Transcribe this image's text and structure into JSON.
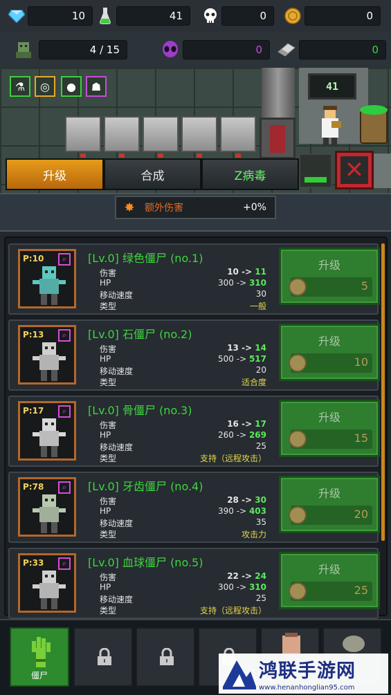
{
  "resources": {
    "gems": "10",
    "potion": "41",
    "skull": "0",
    "coins": "0",
    "zombies": "4 / 15",
    "alien": "0",
    "eraser": "0"
  },
  "scene": {
    "screen_counter": "41"
  },
  "tabs": [
    {
      "label": "升级"
    },
    {
      "label": "合成"
    },
    {
      "label": "Z病毒"
    }
  ],
  "bonus": {
    "label": "额外伤害",
    "value": "+0%"
  },
  "stat_labels": {
    "damage": "伤害",
    "hp": "HP",
    "speed": "移动速度",
    "type": "类型"
  },
  "upgrade_label": "升级",
  "zombies": [
    {
      "power": "P:10",
      "title": "[Lv.0] 绿色僵尸 (no.1)",
      "damage_from": "10",
      "damage_to": "11",
      "hp_from": "300",
      "hp_to": "310",
      "speed": "30",
      "type": "一般",
      "cost": "5",
      "color": "#5fc7c0"
    },
    {
      "power": "P:13",
      "title": "[Lv.0] 石僵尸 (no.2)",
      "damage_from": "13",
      "damage_to": "14",
      "hp_from": "500",
      "hp_to": "517",
      "speed": "20",
      "type": "适合度",
      "cost": "10",
      "color": "#cfcfcf"
    },
    {
      "power": "P:17",
      "title": "[Lv.0] 骨僵尸 (no.3)",
      "damage_from": "16",
      "damage_to": "17",
      "hp_from": "260",
      "hp_to": "269",
      "speed": "25",
      "type": "支持（远程攻击）",
      "cost": "15",
      "color": "#d9d9d9"
    },
    {
      "power": "P:78",
      "title": "[Lv.0] 牙齿僵尸 (no.4)",
      "damage_from": "28",
      "damage_to": "30",
      "hp_from": "390",
      "hp_to": "403",
      "speed": "35",
      "type": "攻击力",
      "cost": "20",
      "color": "#b8c9b0"
    },
    {
      "power": "P:33",
      "title": "[Lv.0] 血球僵尸 (no.5)",
      "damage_from": "22",
      "damage_to": "24",
      "hp_from": "300",
      "hp_to": "310",
      "speed": "25",
      "type": "支持（远程攻击）",
      "cost": "25",
      "color": "#d0d0d0"
    }
  ],
  "bottom_nav": {
    "active_label": "僵尸"
  },
  "watermark": {
    "name": "鸿联手游网",
    "url": "www.henanhonglian95.com"
  }
}
